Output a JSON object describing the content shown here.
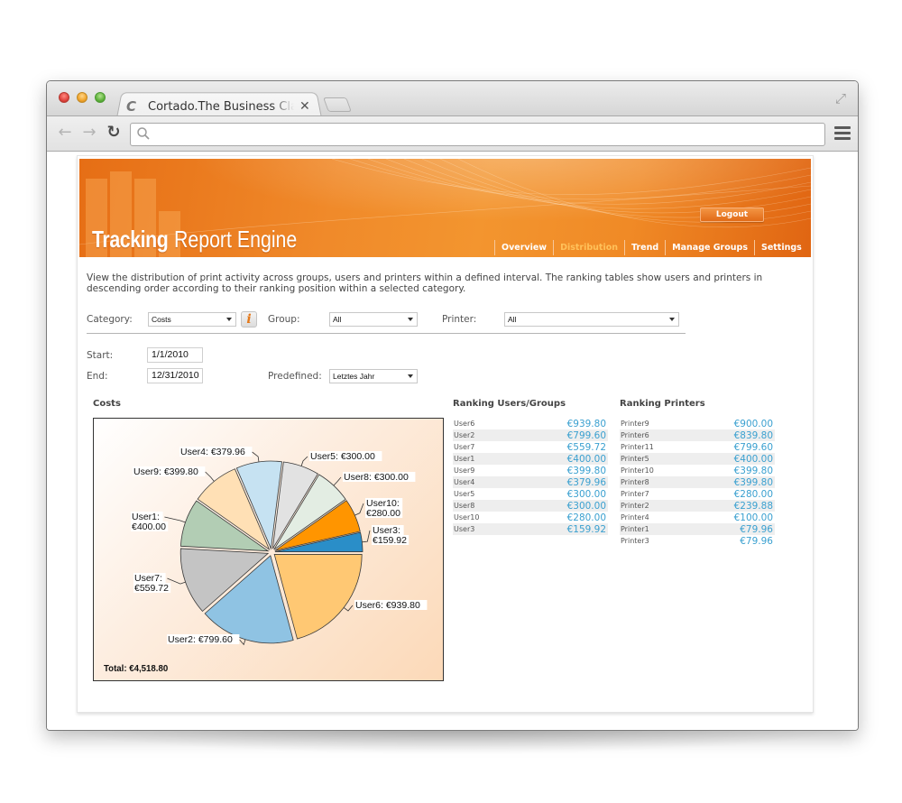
{
  "browser": {
    "tab_title": "Cortado.The Business Class",
    "tab_close": "✕",
    "favicon": "C",
    "address_value": "",
    "back_icon": "←",
    "forward_icon": "→",
    "reload_icon": "↻",
    "fullscreen_icon": "⤢"
  },
  "header": {
    "brand_bold": "Tracking",
    "brand_light": "Report Engine",
    "logout_label": "Logout",
    "nav": [
      {
        "label": "Overview",
        "active": false
      },
      {
        "label": "Distribution",
        "active": true
      },
      {
        "label": "Trend",
        "active": false
      },
      {
        "label": "Manage Groups",
        "active": false
      },
      {
        "label": "Settings",
        "active": false
      }
    ],
    "colors": {
      "accent": "#f08a26",
      "active_nav": "#ffc15a"
    }
  },
  "intro_text": "View the distribution of print activity across groups, users and printers within a defined interval. The ranking tables show users and printers in descending order according to their ranking position within a selected category.",
  "filters": {
    "category_label": "Category:",
    "category_value": "Costs",
    "info_icon": "i",
    "group_label": "Group:",
    "group_value": "All",
    "printer_label": "Printer:",
    "printer_value": "All",
    "start_label": "Start:",
    "start_value": "1/1/2010",
    "end_label": "End:",
    "end_value": "12/31/2010",
    "predefined_label": "Predefined:",
    "predefined_value": "Letztes Jahr"
  },
  "chart_section_title": "Costs",
  "chart_data": {
    "type": "pie",
    "title": "Costs",
    "start_angle": "3 o'clock, clockwise",
    "slices": [
      {
        "label": "User6",
        "value": 939.8,
        "display": "User6: €939.80",
        "color": "#ffc873"
      },
      {
        "label": "User2",
        "value": 799.6,
        "display": "User2: €799.60",
        "color": "#8fc3e3"
      },
      {
        "label": "User7",
        "value": 559.72,
        "display": "User7:\n€559.72",
        "color": "#c4c4c4"
      },
      {
        "label": "User1",
        "value": 400.0,
        "display": "User1:\n€400.00",
        "color": "#b2cdb4"
      },
      {
        "label": "User9",
        "value": 399.8,
        "display": "User9: €399.80",
        "color": "#ffe0b5"
      },
      {
        "label": "User4",
        "value": 379.96,
        "display": "User4: €379.96",
        "color": "#c6e2f2"
      },
      {
        "label": "User5",
        "value": 300.0,
        "display": "User5: €300.00",
        "color": "#e2e2e2"
      },
      {
        "label": "User8",
        "value": 300.0,
        "display": "User8: €300.00",
        "color": "#e3ede3"
      },
      {
        "label": "User10",
        "value": 280.0,
        "display": "User10:\n€280.00",
        "color": "#ff9500"
      },
      {
        "label": "User3",
        "value": 159.92,
        "display": "User3:\n€159.92",
        "color": "#2a8ec8"
      }
    ],
    "total_label": "Total: €4,518.80",
    "legend": "none (labels on slices)"
  },
  "ranking_users": {
    "title": "Ranking Users/Groups",
    "rows": [
      {
        "name": "User6",
        "value": "€939.80"
      },
      {
        "name": "User2",
        "value": "€799.60"
      },
      {
        "name": "User7",
        "value": "€559.72"
      },
      {
        "name": "User1",
        "value": "€400.00"
      },
      {
        "name": "User9",
        "value": "€399.80"
      },
      {
        "name": "User4",
        "value": "€379.96"
      },
      {
        "name": "User5",
        "value": "€300.00"
      },
      {
        "name": "User8",
        "value": "€300.00"
      },
      {
        "name": "User10",
        "value": "€280.00"
      },
      {
        "name": "User3",
        "value": "€159.92"
      }
    ]
  },
  "ranking_printers": {
    "title": "Ranking Printers",
    "rows": [
      {
        "name": "Printer9",
        "value": "€900.00"
      },
      {
        "name": "Printer6",
        "value": "€839.80"
      },
      {
        "name": "Printer11",
        "value": "€799.60"
      },
      {
        "name": "Printer5",
        "value": "€400.00"
      },
      {
        "name": "Printer10",
        "value": "€399.80"
      },
      {
        "name": "Printer8",
        "value": "€399.80"
      },
      {
        "name": "Printer7",
        "value": "€280.00"
      },
      {
        "name": "Printer2",
        "value": "€239.88"
      },
      {
        "name": "Printer4",
        "value": "€100.00"
      },
      {
        "name": "Printer1",
        "value": "€79.96"
      },
      {
        "name": "Printer3",
        "value": "€79.96"
      }
    ]
  }
}
